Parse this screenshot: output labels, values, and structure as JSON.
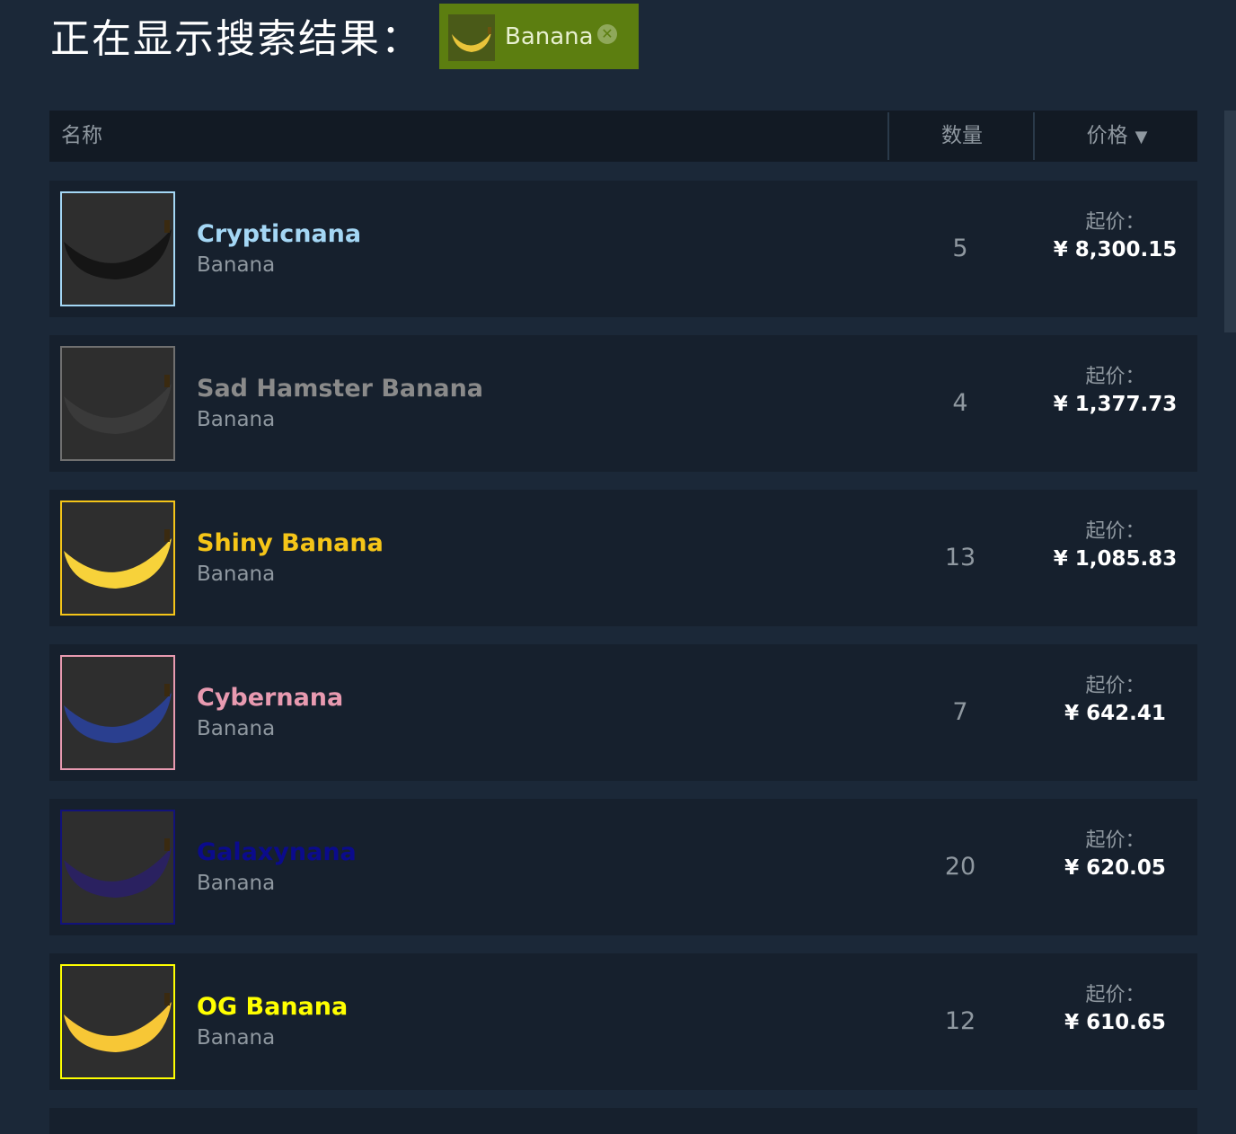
{
  "header": {
    "title": "正在显示搜索结果：",
    "filter_tag": {
      "label": "Banana",
      "close_icon": "close-circle-icon",
      "thumb_icon": "banana-icon"
    }
  },
  "table": {
    "columns": {
      "name": "名称",
      "quantity": "数量",
      "price": "价格",
      "price_sort_icon": "▼"
    }
  },
  "items": [
    {
      "name": "Crypticnana",
      "game": "Banana",
      "quantity": "5",
      "price_label": "起价：",
      "price": "¥ 8,300.15",
      "name_color": "#a4d7f5",
      "border_color": "#a4d7f5",
      "banana_color": "#151515",
      "icon": "black-banana-icon"
    },
    {
      "name": "Sad Hamster Banana",
      "game": "Banana",
      "quantity": "4",
      "price_label": "起价：",
      "price": "¥ 1,377.73",
      "name_color": "#8a8a8a",
      "border_color": "#707070",
      "banana_color": "#3a3a3a",
      "icon": "hamster-banana-icon"
    },
    {
      "name": "Shiny Banana",
      "game": "Banana",
      "quantity": "13",
      "price_label": "起价：",
      "price": "¥ 1,085.83",
      "name_color": "#f5c518",
      "border_color": "#f5c518",
      "banana_color": "#f7d23a",
      "icon": "yellow-banana-icon"
    },
    {
      "name": "Cybernana",
      "game": "Banana",
      "quantity": "7",
      "price_label": "起价：",
      "price": "¥ 642.41",
      "name_color": "#e89ab0",
      "border_color": "#e89ab0",
      "banana_color": "#2a3f8f",
      "icon": "cyber-banana-icon"
    },
    {
      "name": "Galaxynana",
      "game": "Banana",
      "quantity": "20",
      "price_label": "起价：",
      "price": "¥ 620.05",
      "name_color": "#0b0b8c",
      "border_color": "#12127a",
      "banana_color": "#2a2160",
      "icon": "galaxy-banana-icon"
    },
    {
      "name": "OG Banana",
      "game": "Banana",
      "quantity": "12",
      "price_label": "起价：",
      "price": "¥ 610.65",
      "name_color": "#ffff00",
      "border_color": "#ffff00",
      "banana_color": "#f7c736",
      "icon": "og-banana-icon"
    }
  ]
}
